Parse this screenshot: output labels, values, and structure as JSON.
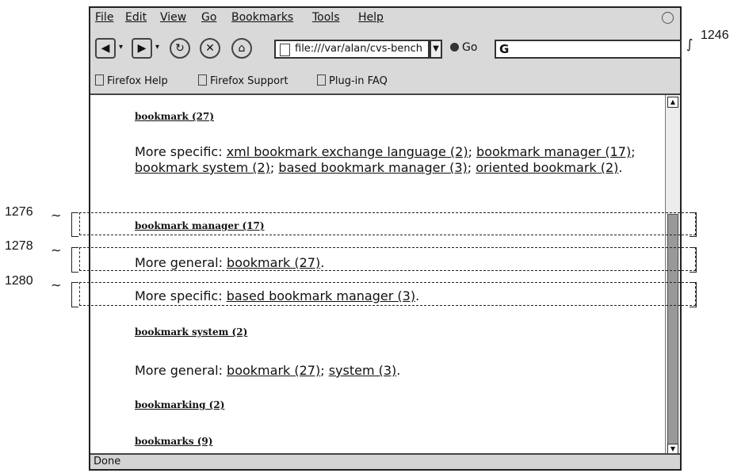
{
  "menu": {
    "file": "File",
    "edit": "Edit",
    "view": "View",
    "go": "Go",
    "bookmarks": "Bookmarks",
    "tools": "Tools",
    "help": "Help"
  },
  "toolbar": {
    "url": "file:///var/alan/cvs-bench",
    "go_label": "Go",
    "search_value": "G"
  },
  "bookmark_bar": [
    "Firefox Help",
    "Firefox Support",
    "Plug-in FAQ"
  ],
  "content": {
    "h1": "bookmark (27)",
    "p1_prefix": "More specific: ",
    "p1_links": [
      "xml bookmark exchange language (2)",
      "bookmark manager (17)",
      "bookmark system (2)",
      "based bookmark manager (3)",
      "oriented bookmark (2)"
    ],
    "h2": "bookmark manager (17)",
    "p2_prefix": "More general: ",
    "p2_link": "bookmark (27)",
    "p3_prefix": "More specific: ",
    "p3_link": "based bookmark manager (3)",
    "h3": "bookmark system (2)",
    "p4_prefix": "More general: ",
    "p4_links": [
      "bookmark (27)",
      "system (3)"
    ],
    "h4": "bookmarking (2)",
    "h5": "bookmarks (9)"
  },
  "status": "Done",
  "refs": {
    "r1246": "1246",
    "r1276": "1276",
    "r1278": "1278",
    "r1280": "1280"
  }
}
